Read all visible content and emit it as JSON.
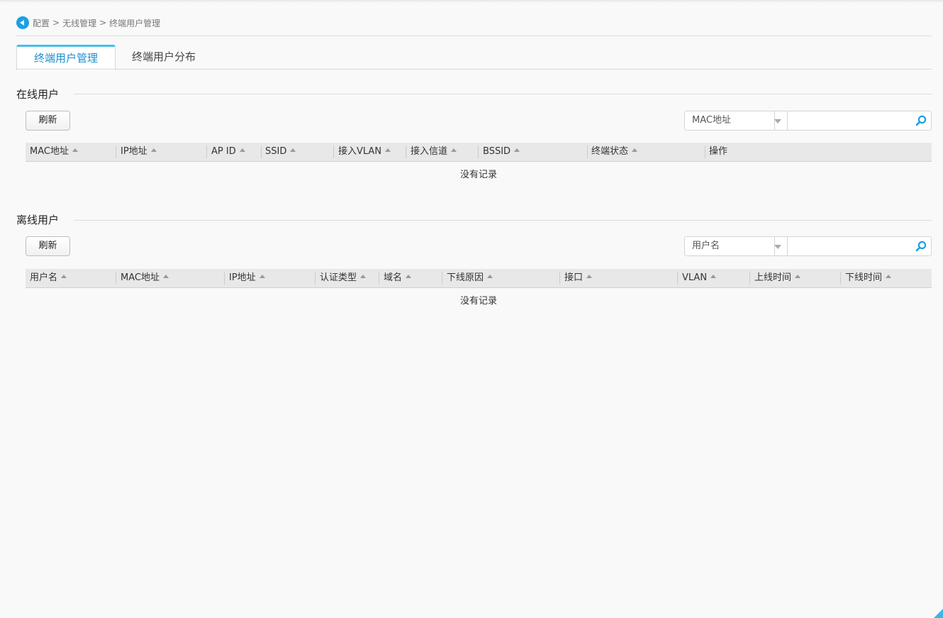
{
  "breadcrumb": {
    "items": [
      "配置",
      "无线管理",
      "终端用户管理"
    ],
    "separator": ">"
  },
  "tabs": [
    {
      "label": "终端用户管理",
      "active": true
    },
    {
      "label": "终端用户分布",
      "active": false
    }
  ],
  "online": {
    "title": "在线用户",
    "refresh_label": "刷新",
    "search": {
      "field": "MAC地址",
      "value": ""
    },
    "columns": [
      "MAC地址",
      "IP地址",
      "AP ID",
      "SSID",
      "接入VLAN",
      "接入信道",
      "BSSID",
      "终端状态",
      "操作"
    ],
    "empty_text": "没有记录"
  },
  "offline": {
    "title": "离线用户",
    "refresh_label": "刷新",
    "search": {
      "field": "用户名",
      "value": ""
    },
    "columns": [
      "用户名",
      "MAC地址",
      "IP地址",
      "认证类型",
      "域名",
      "下线原因",
      "接口",
      "VLAN",
      "上线时间",
      "下线时间"
    ],
    "empty_text": "没有记录"
  },
  "colors": {
    "accent": "#1aa0e6",
    "tab_top": "#45c0ec",
    "active_tab_text": "#1c8fce"
  },
  "icons": {
    "back": "back-arrow-icon",
    "search": "search-icon",
    "dropdown": "chevron-down-icon"
  }
}
